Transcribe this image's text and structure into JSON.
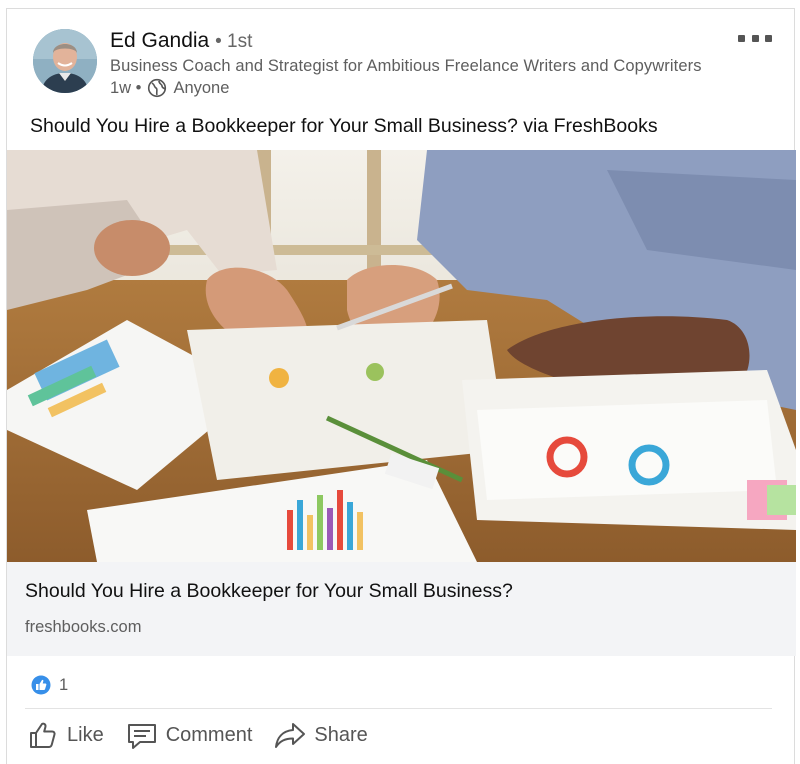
{
  "post": {
    "author_name": "Ed Gandia",
    "connection_degree": "• 1st",
    "author_headline": "Business Coach and Strategist for Ambitious Freelance Writers and Copywriters",
    "time_ago": "1w •",
    "visibility": "Anyone",
    "text": "Should You Hire a Bookkeeper for Your Small Business? via FreshBooks"
  },
  "article": {
    "title": "Should You Hire a Bookkeeper for Your Small Business?",
    "source": "freshbooks.com"
  },
  "social": {
    "reaction_count": "1",
    "actions": [
      {
        "label": "Like",
        "icon": "thumbs-up-icon"
      },
      {
        "label": "Comment",
        "icon": "comment-icon"
      },
      {
        "label": "Share",
        "icon": "share-arrow-icon"
      }
    ]
  },
  "colors": {
    "like_blue": "#378fe9",
    "muted_text": "#5e5e5e",
    "article_bg": "#f3f4f6"
  }
}
